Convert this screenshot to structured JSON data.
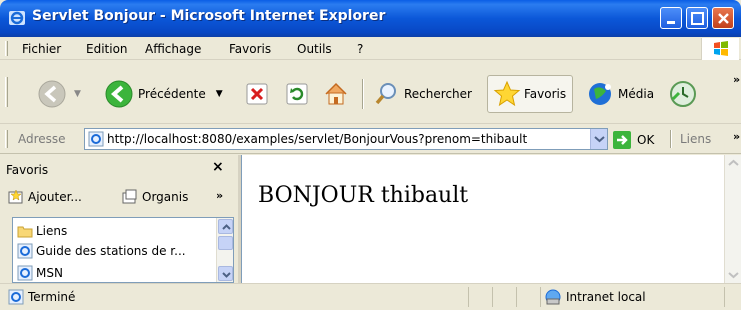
{
  "window": {
    "title": "Servlet Bonjour - Microsoft Internet Explorer"
  },
  "menu": {
    "items": [
      "Fichier",
      "Edition",
      "Affichage",
      "Favoris",
      "Outils",
      "?"
    ]
  },
  "toolbar": {
    "back_label": "Précédente",
    "search_label": "Rechercher",
    "favorites_label": "Favoris",
    "media_label": "Média"
  },
  "address": {
    "label": "Adresse",
    "url": "http://localhost:8080/examples/servlet/BonjourVous?prenom=thibault",
    "go_label": "OK",
    "links_label": "Liens"
  },
  "favorites": {
    "title": "Favoris",
    "add_label": "Ajouter...",
    "organize_label": "Organis",
    "items": [
      "Liens",
      "Guide des stations de r...",
      "MSN"
    ]
  },
  "page": {
    "heading": "BONJOUR thibault"
  },
  "status": {
    "text": "Terminé",
    "zone": "Intranet local"
  },
  "colors": {
    "titlebar": "#0b57d8",
    "chrome": "#ece9d8",
    "accent_green": "#3cb43c"
  }
}
